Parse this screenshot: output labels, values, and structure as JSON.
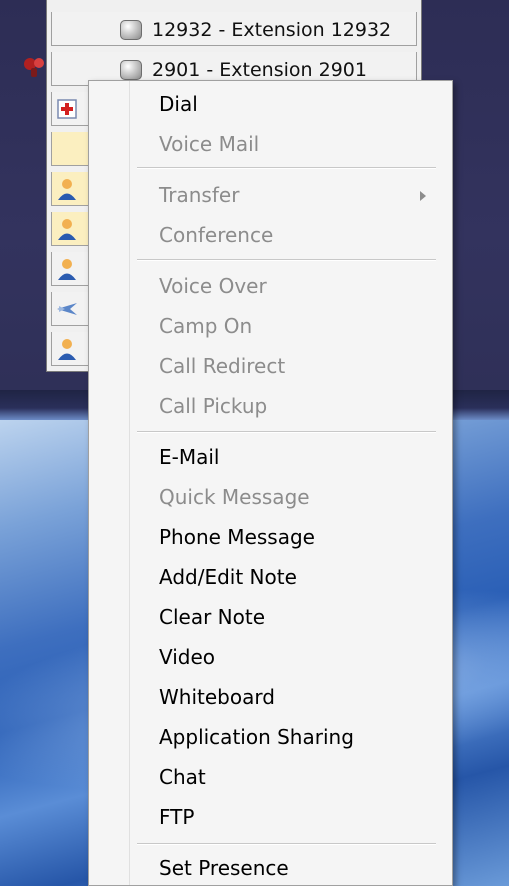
{
  "contacts": [
    {
      "label": "12932 - Extension 12932",
      "icon": "status-dot-icon"
    },
    {
      "label": "2901 - Extension 2901",
      "icon": "telephone-icon"
    }
  ],
  "context_menu": {
    "items": [
      {
        "label": "Dial",
        "enabled": true
      },
      {
        "label": "Voice Mail",
        "enabled": false
      },
      {
        "label": "Transfer",
        "enabled": false,
        "submenu": true
      },
      {
        "label": "Conference",
        "enabled": false
      },
      {
        "label": "Voice Over",
        "enabled": false
      },
      {
        "label": "Camp On",
        "enabled": false
      },
      {
        "label": "Call Redirect",
        "enabled": false
      },
      {
        "label": "Call Pickup",
        "enabled": false
      },
      {
        "label": "E-Mail",
        "enabled": true
      },
      {
        "label": "Quick Message",
        "enabled": false
      },
      {
        "label": "Phone Message",
        "enabled": true
      },
      {
        "label": "Add/Edit Note",
        "enabled": true
      },
      {
        "label": "Clear Note",
        "enabled": true
      },
      {
        "label": "Video",
        "enabled": true
      },
      {
        "label": "Whiteboard",
        "enabled": true
      },
      {
        "label": "Application Sharing",
        "enabled": true
      },
      {
        "label": "Chat",
        "enabled": true
      },
      {
        "label": "FTP",
        "enabled": true
      },
      {
        "label": "Set Presence",
        "enabled": true
      }
    ]
  },
  "colors": {
    "enabled_text": "#000000",
    "disabled_text": "#8c8c8c",
    "highlight_row": "#fbefc0"
  }
}
